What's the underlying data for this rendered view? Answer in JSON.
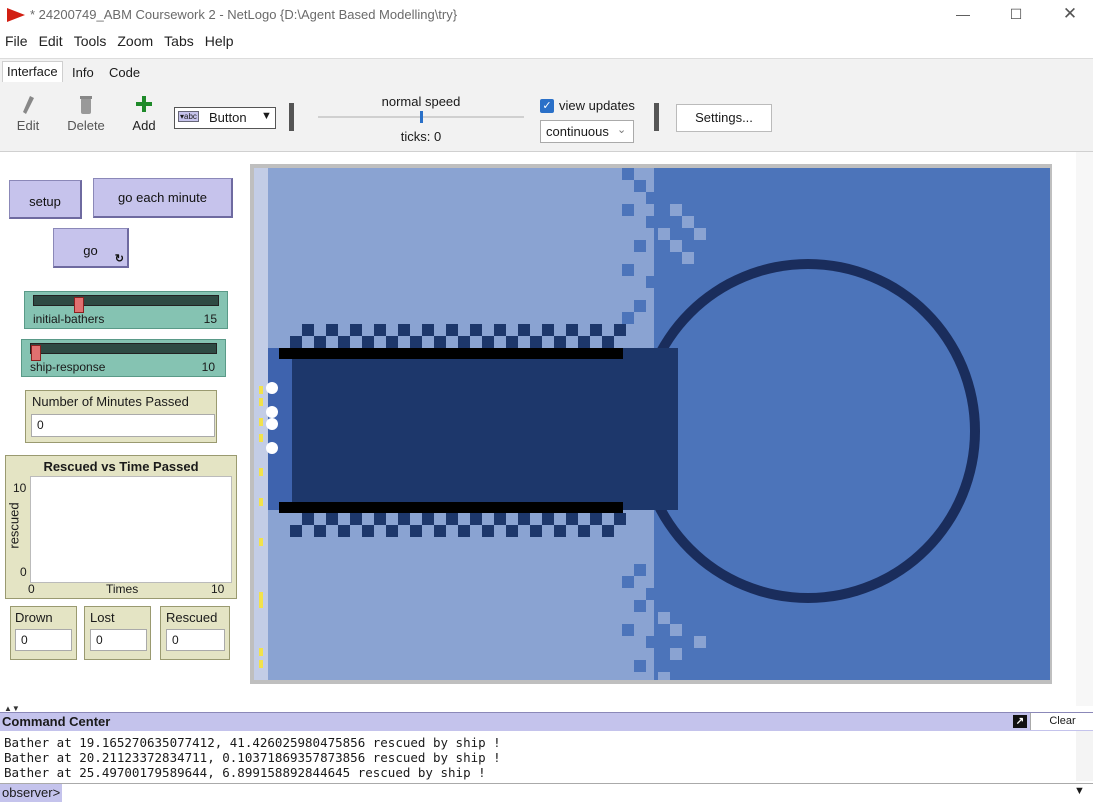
{
  "window": {
    "title": "* 24200749_ABM Coursework 2 - NetLogo {D:\\Agent Based Modelling\\try}",
    "minimize_icon": "minimize-icon",
    "maximize_icon": "maximize-icon",
    "close_icon": "close-icon"
  },
  "menu": [
    "File",
    "Edit",
    "Tools",
    "Zoom",
    "Tabs",
    "Help"
  ],
  "tabs": [
    "Interface",
    "Info",
    "Code"
  ],
  "toolbar": {
    "edit": "Edit",
    "delete": "Delete",
    "add": "Add",
    "widget_type": "Button",
    "speed_label": "normal speed",
    "ticks_label": "ticks: 0",
    "view_updates": "view updates",
    "update_mode": "continuous",
    "settings": "Settings..."
  },
  "widgets": {
    "setup": "setup",
    "go_each_minute": "go each minute",
    "go": "go",
    "slider_bathers": {
      "label": "initial-bathers",
      "value": "15",
      "fraction": 0.23
    },
    "slider_ship": {
      "label": "ship-response",
      "value": "10",
      "fraction": 0.0
    },
    "minutes_monitor": {
      "label": "Number of Minutes Passed",
      "value": "0"
    },
    "plot": {
      "title": "Rescued vs Time Passed",
      "ylabel": "rescued",
      "xlabel": "Times",
      "ymax": "10",
      "ymin": "0",
      "xmin": "0",
      "xmax": "10"
    },
    "drown": {
      "label": "Drown",
      "value": "0"
    },
    "lost": {
      "label": "Lost",
      "value": "0"
    },
    "rescued": {
      "label": "Rescued",
      "value": "0"
    }
  },
  "colors": {
    "shallow": "#8aa3d2",
    "mid": "#4c74ba",
    "deep": "#1d376b",
    "darkest": "#1a2d5c",
    "button": "#c6c3ec",
    "slider": "#85c3b2",
    "monitor": "#e4e4c4"
  },
  "command_center": {
    "title": "Command Center",
    "clear": "Clear",
    "lines": [
      "Bather at 19.165270635077412, 41.426025980475856 rescued by ship !",
      "Bather at 20.21123372834711, 0.10371869357873856 rescued by ship !",
      "Bather at 25.49700179589644, 6.899158892844645 rescued by ship !"
    ],
    "prompt": "observer>"
  }
}
